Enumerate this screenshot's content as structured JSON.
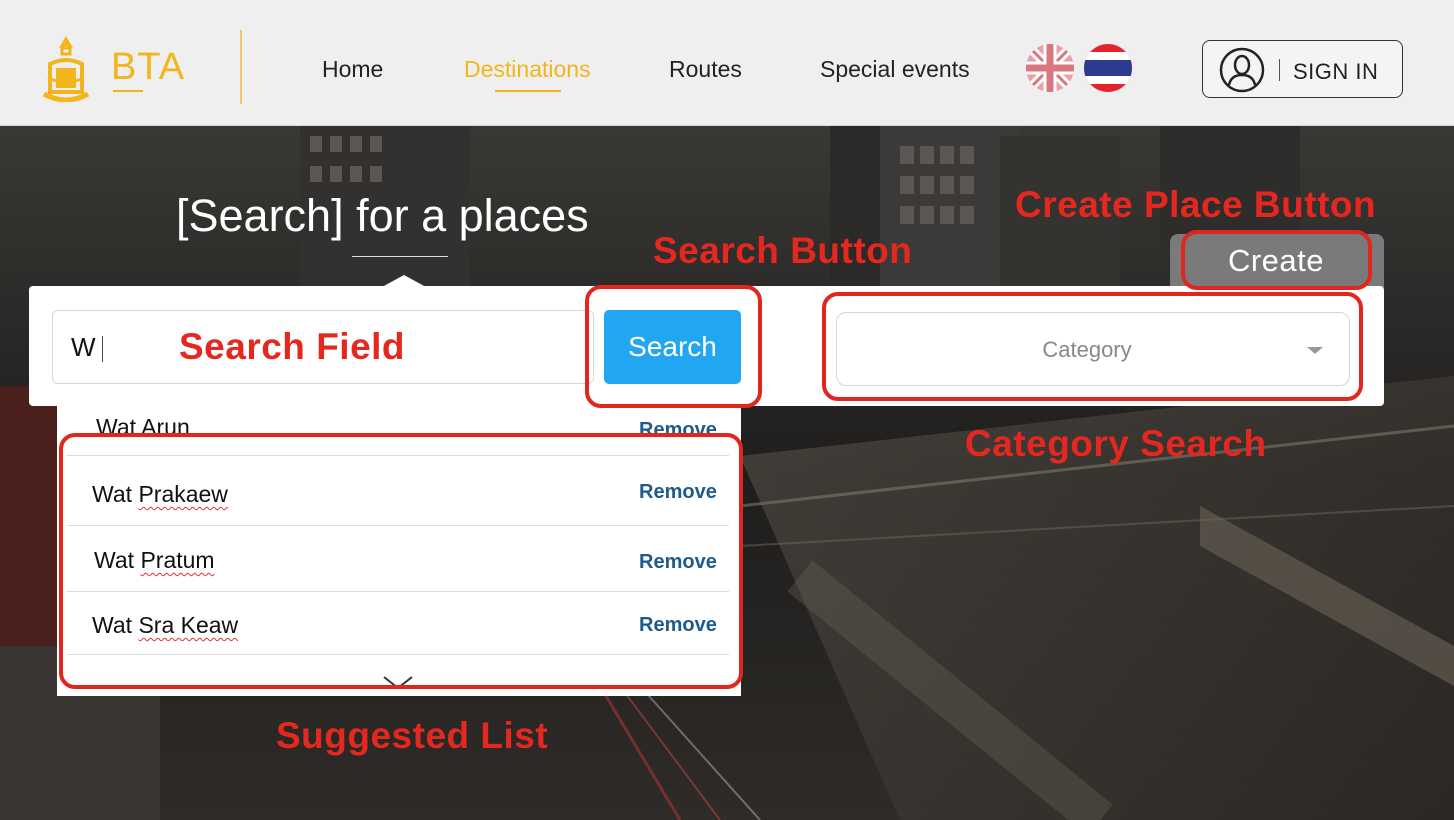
{
  "header": {
    "logo_text": "BTA",
    "nav": [
      {
        "label": "Home",
        "active": false
      },
      {
        "label": "Destinations",
        "active": true
      },
      {
        "label": "Routes",
        "active": false
      },
      {
        "label": "Special events",
        "active": false
      }
    ],
    "languages": [
      "uk-flag-icon",
      "thailand-flag-icon"
    ],
    "signin_label": "SIGN IN"
  },
  "hero": {
    "title": "[Search] for a places"
  },
  "search": {
    "value": "W",
    "button_label": "Search",
    "category_placeholder": "Category",
    "create_label": "Create"
  },
  "suggestions": {
    "items": [
      {
        "first": "Wat ",
        "second": "Arun",
        "remove": "Remove"
      },
      {
        "first": "Wat ",
        "second": "Prakaew",
        "remove": "Remove"
      },
      {
        "first": "Wat ",
        "second": "Pratum",
        "remove": "Remove"
      },
      {
        "first": "Wat ",
        "second": "Sra Keaw",
        "remove": "Remove"
      }
    ]
  },
  "annotations": {
    "create_place": "Create Place Button",
    "search_button": "Search Button",
    "search_field": "Search Field",
    "category_search": "Category Search",
    "suggested_list": "Suggested List"
  },
  "colors": {
    "accent": "#f2b61c",
    "search_button": "#21a7f1",
    "annotation": "#e0261d",
    "remove_link": "#1e5b8c"
  }
}
